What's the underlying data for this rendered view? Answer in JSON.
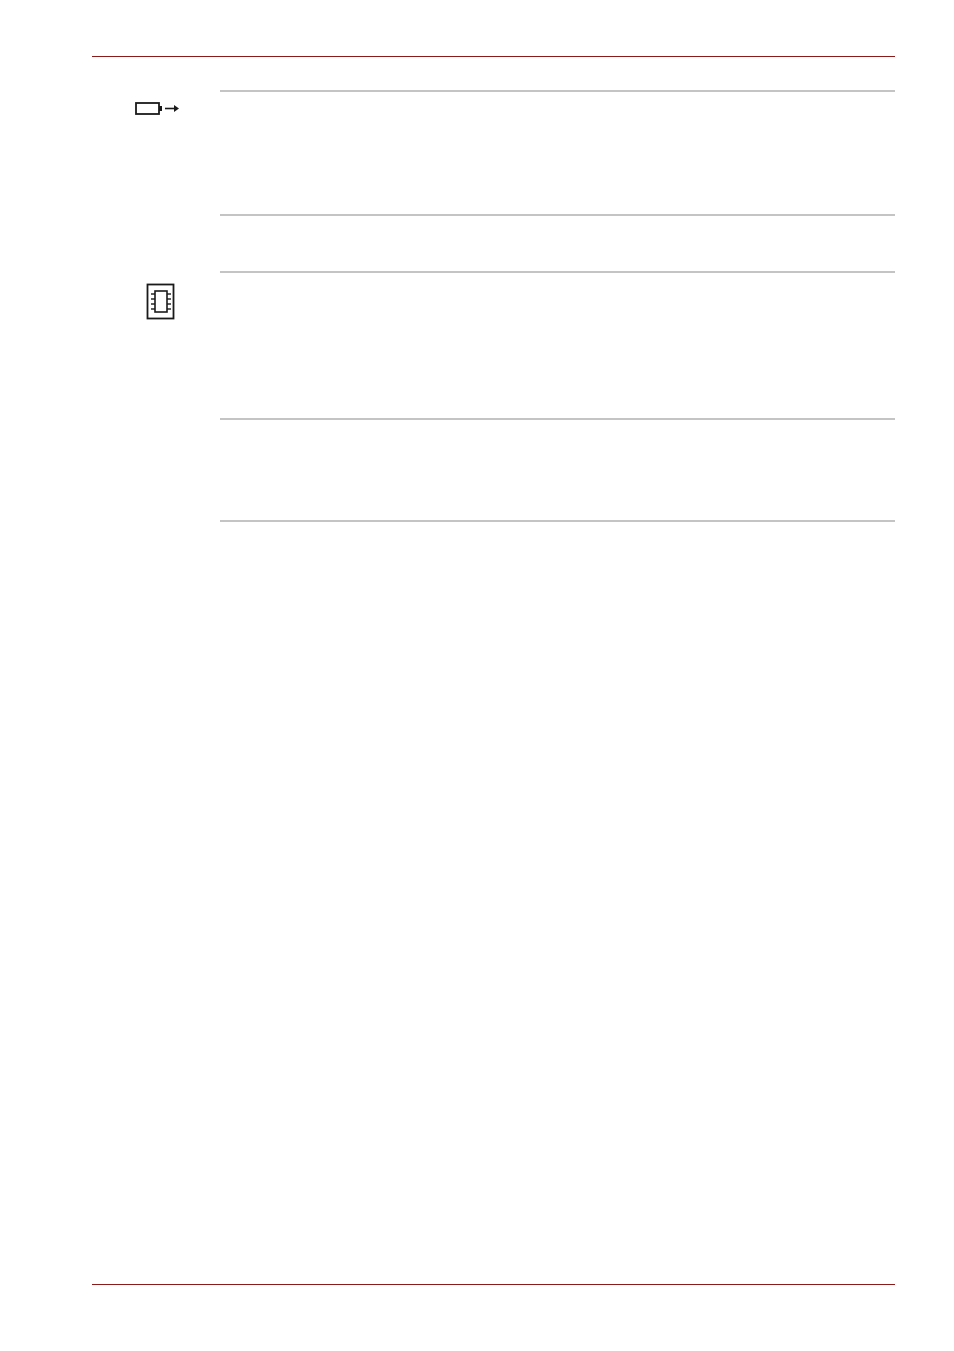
{
  "page": {
    "header_rule": "",
    "footer_rule": ""
  },
  "colors": {
    "accent_rule": "#8b1a1a",
    "table_rule": "#c4c4c4",
    "icon_stroke": "#1a1a1a"
  },
  "icons": {
    "battery": "battery-out-arrow-icon",
    "memory": "memory-chip-icon"
  }
}
